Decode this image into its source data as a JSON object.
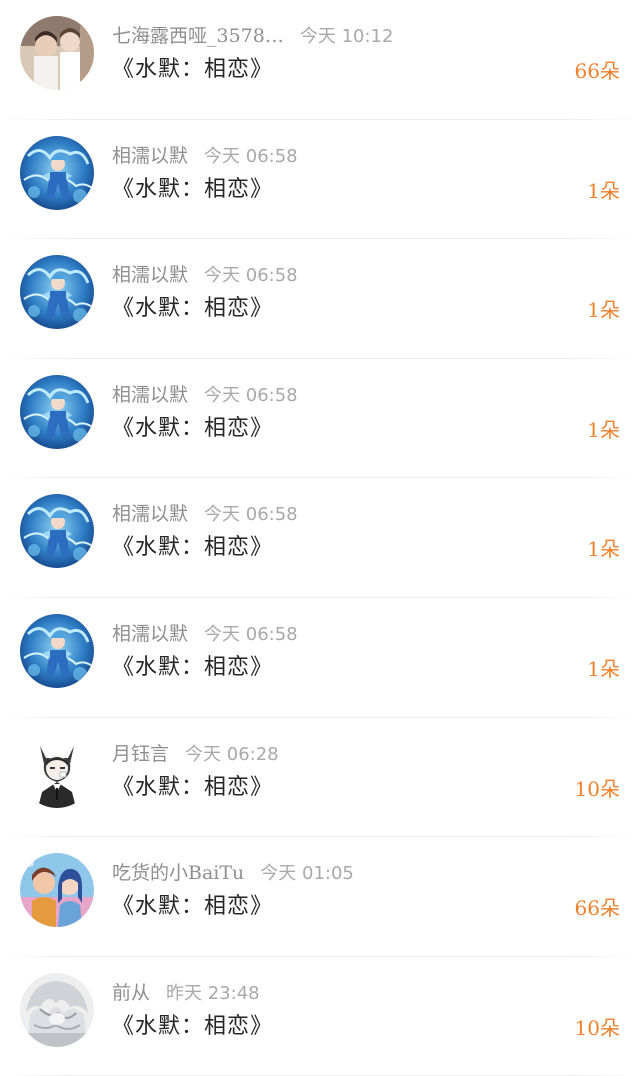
{
  "gift_list": {
    "items": [
      {
        "name": "七海露西哑_3578…",
        "time": "今天 10:12",
        "title": "《水默：相恋》",
        "count": "66朵",
        "avatar": "photo-avatar"
      },
      {
        "name": "相濡以默",
        "time": "今天 06:58",
        "title": "《水默：相恋》",
        "count": "1朵",
        "avatar": "anime-blue-avatar"
      },
      {
        "name": "相濡以默",
        "time": "今天 06:58",
        "title": "《水默：相恋》",
        "count": "1朵",
        "avatar": "anime-blue-avatar"
      },
      {
        "name": "相濡以默",
        "time": "今天 06:58",
        "title": "《水默：相恋》",
        "count": "1朵",
        "avatar": "anime-blue-avatar"
      },
      {
        "name": "相濡以默",
        "time": "今天 06:58",
        "title": "《水默：相恋》",
        "count": "1朵",
        "avatar": "anime-blue-avatar"
      },
      {
        "name": "相濡以默",
        "time": "今天 06:58",
        "title": "《水默：相恋》",
        "count": "1朵",
        "avatar": "anime-blue-avatar"
      },
      {
        "name": "月钰言",
        "time": "今天 06:28",
        "title": "《水默：相恋》",
        "count": "10朵",
        "avatar": "cat-boy-avatar"
      },
      {
        "name": "吃货的小BaiTu",
        "time": "今天 01:05",
        "title": "《水默：相恋》",
        "count": "66朵",
        "avatar": "anime-couple-avatar"
      },
      {
        "name": "前从",
        "time": "昨天 23:48",
        "title": "《水默：相恋》",
        "count": "10朵",
        "avatar": "silver-hair-avatar"
      }
    ]
  },
  "colors": {
    "accent": "#f0802c",
    "name_text": "#8f8f8f",
    "title_text": "#262626",
    "divider": "#ececec"
  }
}
